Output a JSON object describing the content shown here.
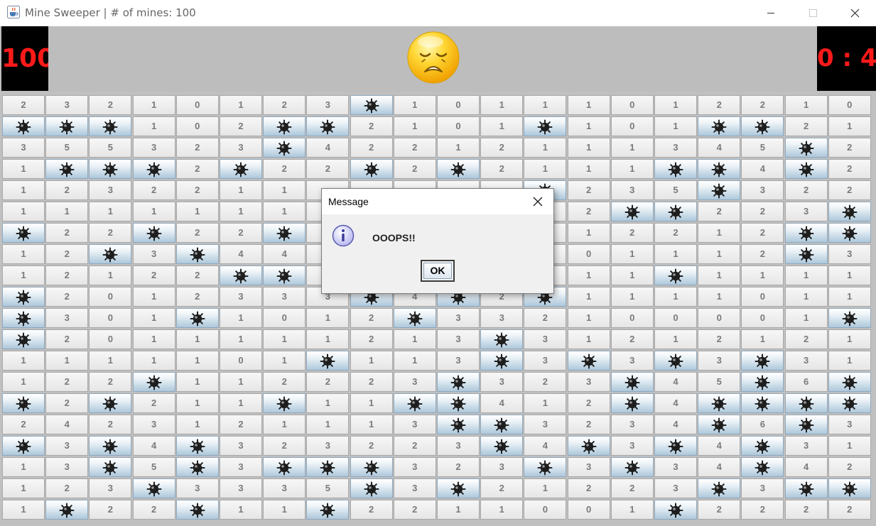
{
  "window": {
    "title": "Mine Sweeper | # of mines: 100",
    "app_icon": "java-coffee-icon",
    "controls": [
      "minimize-icon",
      "maximize-icon",
      "close-icon"
    ]
  },
  "header": {
    "mine_counter": "100",
    "face": "sad-face-icon",
    "timer": "0 : 4"
  },
  "colors": {
    "led_text": "#ff1a1a",
    "led_background": "#000000",
    "header_background": "#bdbdbd",
    "number_text": "#7a7a7a",
    "mine_cell_blue": "#c9dbe8"
  },
  "board": {
    "cell_icon_mine": "mine-icon",
    "rows": [
      [
        "2",
        "3",
        "2",
        "1",
        "0",
        "1",
        "2",
        "3",
        "*",
        "1",
        "0",
        "1",
        "1",
        "1",
        "0",
        "1",
        "2",
        "2",
        "1",
        "0"
      ],
      [
        "*",
        "*",
        "*",
        "1",
        "0",
        "2",
        "*",
        "*",
        "2",
        "1",
        "0",
        "1",
        "*",
        "1",
        "0",
        "1",
        "*",
        "*",
        "2",
        "1"
      ],
      [
        "3",
        "5",
        "5",
        "3",
        "2",
        "3",
        "*",
        "4",
        "2",
        "2",
        "1",
        "2",
        "1",
        "1",
        "1",
        "3",
        "4",
        "5",
        "*",
        "2"
      ],
      [
        "1",
        "*",
        "*",
        "*",
        "2",
        "*",
        "2",
        "2",
        "*",
        "2",
        "*",
        "2",
        "1",
        "1",
        "1",
        "*",
        "*",
        "4",
        "*",
        "2"
      ],
      [
        "1",
        "2",
        "3",
        "2",
        "2",
        "1",
        "1",
        "",
        "",
        "",
        "",
        "",
        "*",
        "2",
        "3",
        "5",
        "*",
        "3",
        "2",
        "2"
      ],
      [
        "1",
        "1",
        "1",
        "1",
        "1",
        "1",
        "1",
        "",
        "",
        "",
        "",
        "",
        "",
        "2",
        "*",
        "*",
        "2",
        "2",
        "3",
        "*"
      ],
      [
        "*",
        "2",
        "2",
        "*",
        "2",
        "2",
        "*",
        "",
        "",
        "",
        "",
        "",
        "",
        "1",
        "2",
        "2",
        "1",
        "2",
        "*",
        "*"
      ],
      [
        "1",
        "2",
        "*",
        "3",
        "*",
        "4",
        "4",
        "",
        "",
        "",
        "",
        "",
        "",
        "0",
        "1",
        "1",
        "1",
        "2",
        "*",
        "3"
      ],
      [
        "1",
        "2",
        "1",
        "2",
        "2",
        "*",
        "*",
        "",
        "",
        "",
        "",
        "",
        "",
        "1",
        "1",
        "*",
        "1",
        "1",
        "1",
        "1"
      ],
      [
        "*",
        "2",
        "0",
        "1",
        "2",
        "3",
        "3",
        "3",
        "*",
        "4",
        "*",
        "2",
        "*",
        "1",
        "1",
        "1",
        "1",
        "0",
        "1",
        "1"
      ],
      [
        "*",
        "3",
        "0",
        "1",
        "*",
        "1",
        "0",
        "1",
        "2",
        "*",
        "3",
        "3",
        "2",
        "1",
        "0",
        "0",
        "0",
        "0",
        "1",
        "*"
      ],
      [
        "*",
        "2",
        "0",
        "1",
        "1",
        "1",
        "1",
        "1",
        "2",
        "1",
        "3",
        "*",
        "3",
        "1",
        "2",
        "1",
        "2",
        "1",
        "2",
        "1"
      ],
      [
        "1",
        "1",
        "1",
        "1",
        "1",
        "0",
        "1",
        "*",
        "1",
        "1",
        "3",
        "*",
        "3",
        "*",
        "3",
        "*",
        "3",
        "*",
        "3",
        "1"
      ],
      [
        "1",
        "2",
        "2",
        "*",
        "1",
        "1",
        "2",
        "2",
        "2",
        "3",
        "*",
        "3",
        "2",
        "3",
        "*",
        "4",
        "5",
        "*",
        "6",
        "*"
      ],
      [
        "*",
        "2",
        "*",
        "2",
        "1",
        "1",
        "*",
        "1",
        "1",
        "*",
        "*",
        "4",
        "1",
        "2",
        "*",
        "4",
        "*",
        "*",
        "*",
        "*"
      ],
      [
        "2",
        "4",
        "2",
        "3",
        "1",
        "2",
        "1",
        "1",
        "1",
        "3",
        "*",
        "*",
        "3",
        "2",
        "3",
        "4",
        "*",
        "6",
        "*",
        "3"
      ],
      [
        "*",
        "3",
        "*",
        "4",
        "*",
        "3",
        "2",
        "3",
        "2",
        "2",
        "3",
        "*",
        "4",
        "*",
        "3",
        "*",
        "4",
        "*",
        "3",
        "1"
      ],
      [
        "1",
        "3",
        "*",
        "5",
        "*",
        "3",
        "*",
        "*",
        "*",
        "3",
        "2",
        "3",
        "*",
        "3",
        "*",
        "3",
        "4",
        "*",
        "4",
        "2"
      ],
      [
        "1",
        "2",
        "3",
        "*",
        "3",
        "3",
        "3",
        "5",
        "*",
        "3",
        "*",
        "2",
        "1",
        "2",
        "2",
        "3",
        "*",
        "3",
        "*",
        "*"
      ],
      [
        "1",
        "*",
        "2",
        "2",
        "*",
        "1",
        "1",
        "*",
        "2",
        "2",
        "1",
        "1",
        "0",
        "0",
        "1",
        "*",
        "2",
        "2",
        "2",
        "2"
      ]
    ]
  },
  "dialog": {
    "title": "Message",
    "icon": "info-icon",
    "message": "OOOPS!!",
    "ok_label": "OK",
    "close_icon": "close-icon"
  }
}
